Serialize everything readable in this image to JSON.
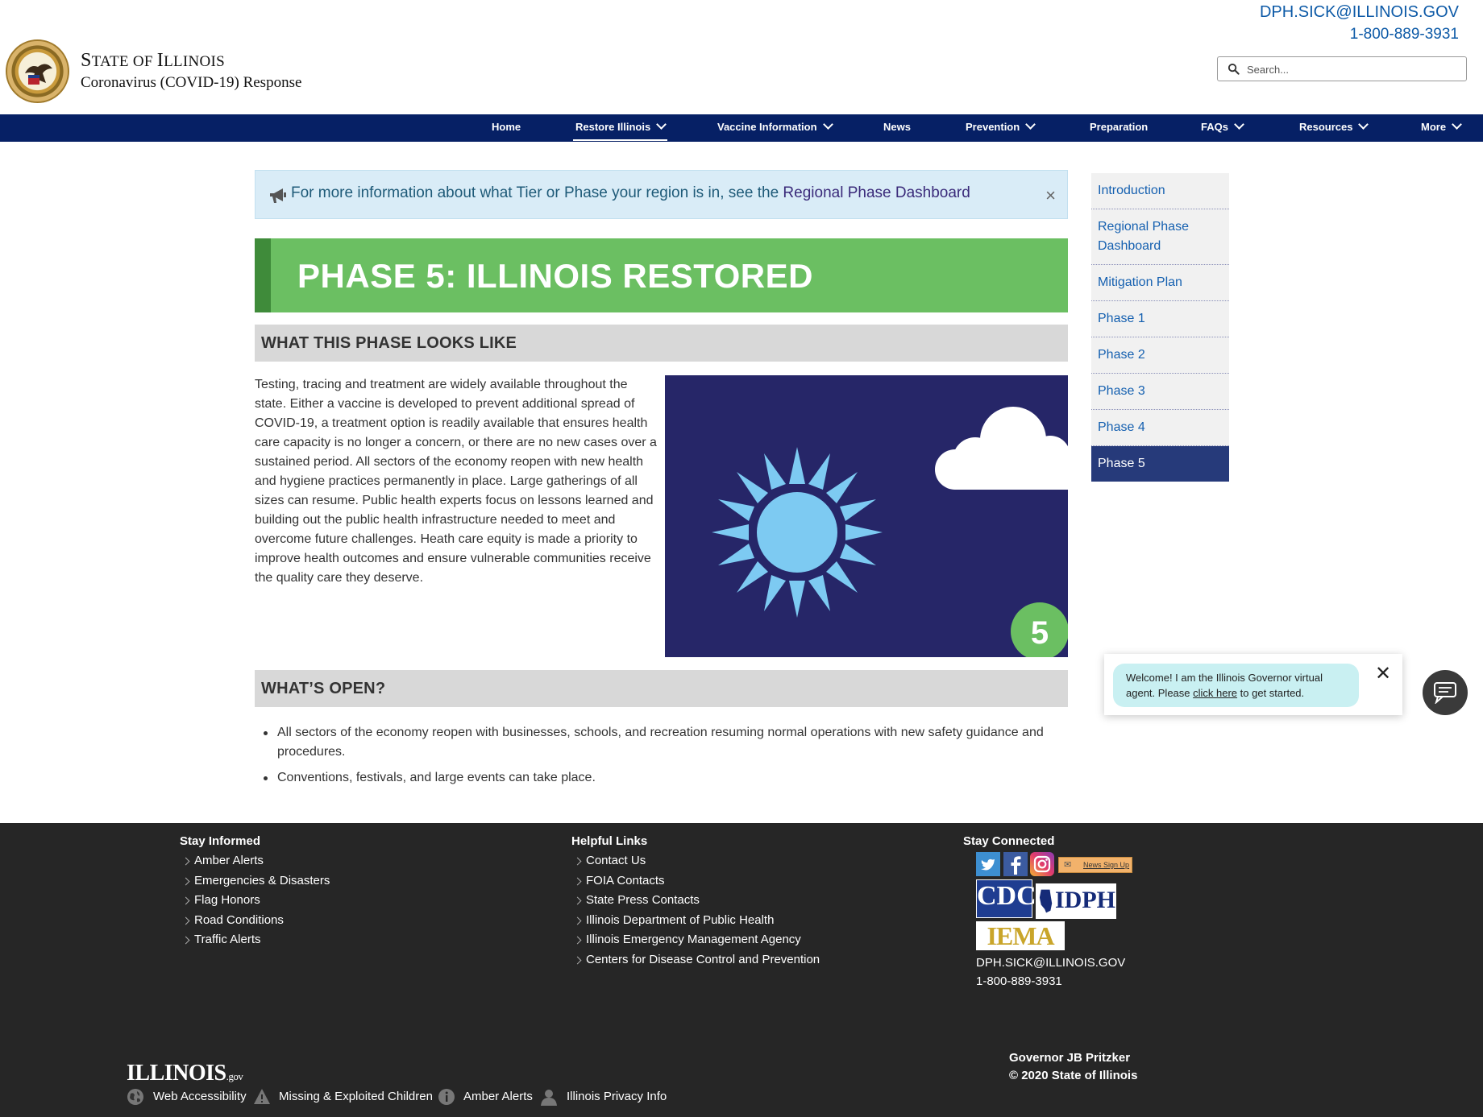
{
  "header": {
    "title_first": "S",
    "title_rest": "TATE OF ",
    "title_il_first": "I",
    "title_il_rest": "LLINOIS",
    "subtitle": "Coronavirus (COVID-19) Response",
    "email": "DPH.SICK@ILLINOIS.GOV",
    "phone": "1-800-889-3931",
    "search_placeholder": "Search..."
  },
  "nav": {
    "items": [
      {
        "label": "Home",
        "dropdown": false
      },
      {
        "label": "Restore Illinois",
        "dropdown": true,
        "active": true
      },
      {
        "label": "Vaccine Information",
        "dropdown": true
      },
      {
        "label": "News",
        "dropdown": false
      },
      {
        "label": "Prevention",
        "dropdown": true
      },
      {
        "label": "Preparation",
        "dropdown": false
      },
      {
        "label": "FAQs",
        "dropdown": true
      },
      {
        "label": "Resources",
        "dropdown": true
      },
      {
        "label": "More",
        "dropdown": true
      }
    ]
  },
  "alert": {
    "text": "For more information about what Tier or Phase your region is in, see the ",
    "link": "Regional Phase Dashboard",
    "close": "×"
  },
  "phase": {
    "title": "PHASE 5: ILLINOIS RESTORED",
    "section_looks": "WHAT THIS PHASE LOOKS LIKE",
    "description": "Testing, tracing and treatment are widely available throughout the state. Either a vaccine is developed to prevent additional spread of COVID-19, a treatment option is readily available that ensures health care capacity is no longer a concern, or there are no new cases over a sustained period. All sectors of the economy reopen with new health and hygiene practices permanently in place. Large gatherings of all sizes can resume. Public health experts focus on lessons learned and building out the public health infrastructure needed to meet and overcome future challenges. Heath care equity is made a priority to improve health outcomes and ensure vulnerable communities receive the quality care they deserve.",
    "image_badge": "5",
    "section_open": "WHAT’S OPEN?",
    "open_items": [
      "All sectors of the economy reopen with businesses, schools, and recreation resuming normal operations with new safety guidance and procedures.",
      "Conventions, festivals, and large events can take place."
    ]
  },
  "side_nav": {
    "items": [
      {
        "label": "Introduction"
      },
      {
        "label": "Regional Phase Dashboard"
      },
      {
        "label": "Mitigation Plan"
      },
      {
        "label": "Phase 1"
      },
      {
        "label": "Phase 2"
      },
      {
        "label": "Phase 3"
      },
      {
        "label": "Phase 4"
      },
      {
        "label": "Phase 5",
        "active": true
      }
    ]
  },
  "chat": {
    "text_before": "Welcome! I am the Illinois Governor virtual agent. Please ",
    "link": "click here",
    "text_after": " to get started.",
    "close": "✕"
  },
  "footer": {
    "stay_informed": {
      "heading": "Stay Informed",
      "links": [
        "Amber Alerts",
        "Emergencies & Disasters",
        "Flag Honors",
        "Road Conditions",
        "Traffic Alerts"
      ]
    },
    "helpful_links": {
      "heading": "Helpful Links",
      "links": [
        "Contact Us",
        "FOIA Contacts",
        "State Press Contacts",
        "Illinois Department of Public Health",
        "Illinois Emergency Management Agency",
        "Centers for Disease Control and Prevention"
      ]
    },
    "stay_connected": {
      "heading": "Stay Connected",
      "news_signup": "News Sign Up",
      "cdc": "CDC",
      "idph": "IDPH",
      "iema": "IEMA",
      "email": "DPH.SICK@ILLINOIS.GOV",
      "phone": "1-800-889-3931"
    },
    "governor": "Governor JB Pritzker",
    "copyright": "© 2020 State of Illinois",
    "logo_main": "ILLINOIS",
    "logo_suffix": ".gov",
    "bottom_links": [
      "Web Accessibility",
      "Missing & Exploited Children",
      "Amber Alerts",
      "Illinois Privacy Info"
    ]
  },
  "colors": {
    "nav_bg": "#062065",
    "phase_green": "#6bbf62",
    "phase_green_dark": "#3f8b3a",
    "link_blue": "#0d5aa7",
    "side_active": "#263a7a",
    "image_bg": "#262668",
    "sun": "#7dcaf2",
    "footer_bg": "#262626"
  },
  "icons": [
    "seal-logo",
    "search-icon",
    "chevron-down-icon",
    "megaphone-icon",
    "close-icon",
    "sun-icon",
    "cloud-icon",
    "chat-icon",
    "twitter-icon",
    "facebook-icon",
    "instagram-icon",
    "mail-icon",
    "globe-icon",
    "warning-icon",
    "info-icon",
    "user-icon"
  ]
}
